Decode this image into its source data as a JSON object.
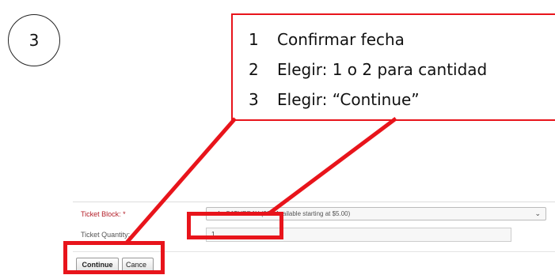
{
  "step_number": "3",
  "callout": {
    "items": [
      {
        "num": "1",
        "text": "Confirmar fecha"
      },
      {
        "num": "2",
        "text": "Elegir: 1 o 2 para cantidad"
      },
      {
        "num": "3",
        "text": "Elegir: “Continue”"
      }
    ]
  },
  "form": {
    "ticket_block_label": "Ticket Block: *",
    "ticket_block_value": "...4 - SATURDAY (20+ Available starting at $5.00)",
    "ticket_quantity_label": "Ticket Quantity:",
    "ticket_quantity_value": "1",
    "continue_label": "Continue",
    "cancel_label": "Cance"
  },
  "colors": {
    "highlight": "#e8141b",
    "required_label": "#b4202a"
  }
}
